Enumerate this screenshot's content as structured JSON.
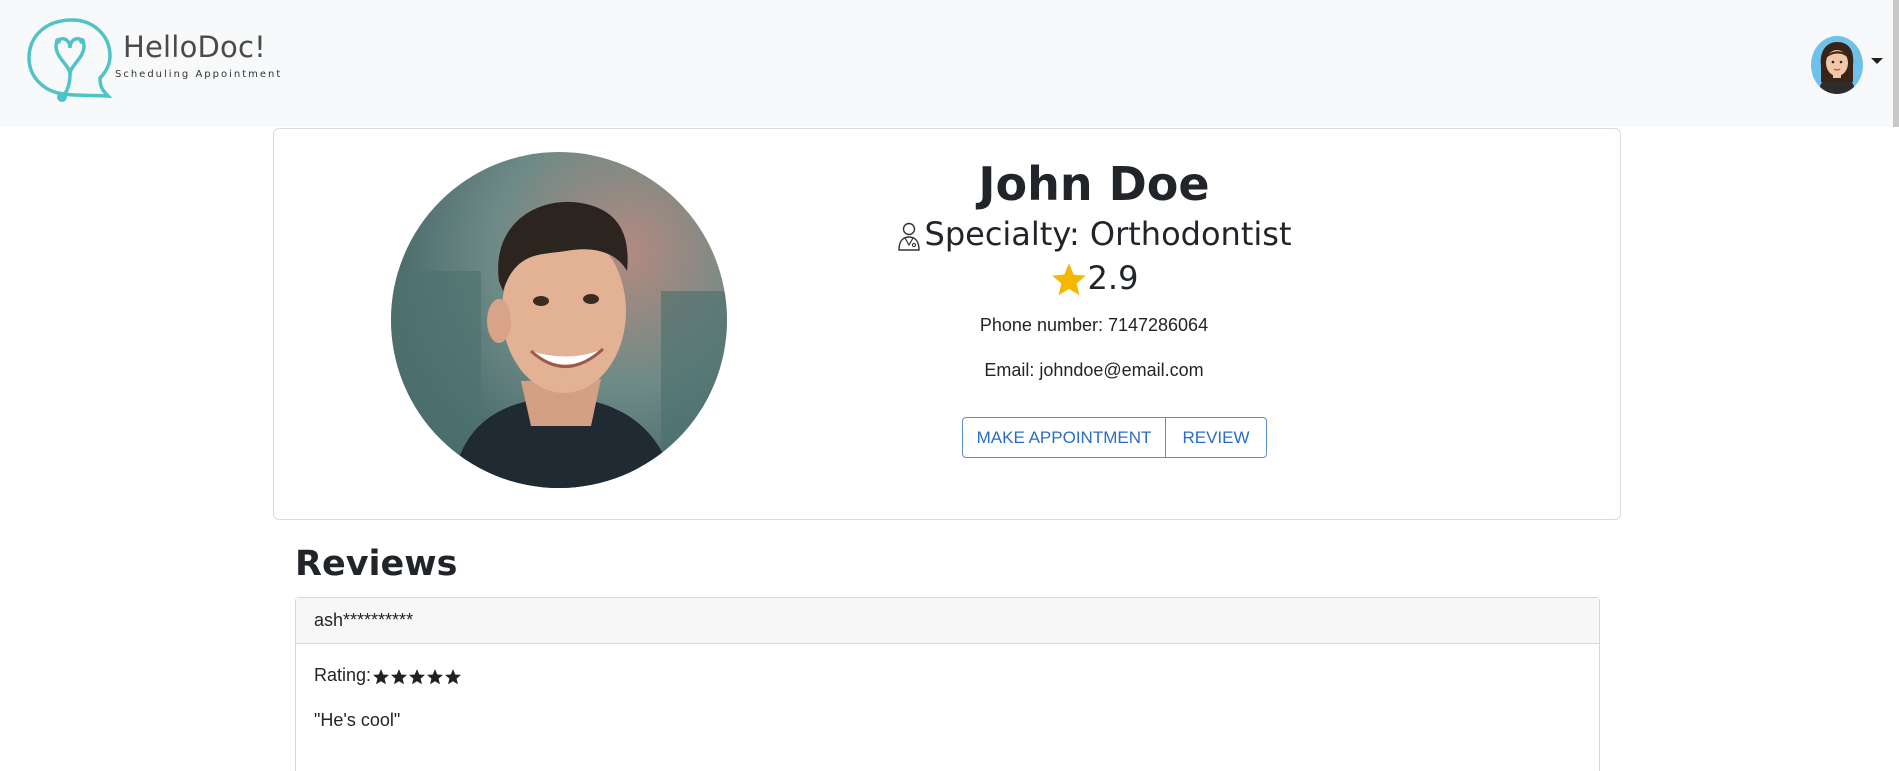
{
  "brand": {
    "name": "HelloDoc!",
    "tagline": "Scheduling Appointment"
  },
  "doctor": {
    "name": "John Doe",
    "specialty": "Specialty: Orthodontist",
    "rating": "2.9",
    "phone": "Phone number: 7147286064",
    "email": "Email: johndoe@email.com"
  },
  "actions": {
    "make_appointment": "MAKE APPOINTMENT",
    "review": "REVIEW"
  },
  "reviews": {
    "title": "Reviews",
    "items": [
      {
        "user": "ash**********",
        "rating_label": "Rating:",
        "stars": 5,
        "text": "\"He's cool\""
      }
    ]
  },
  "colors": {
    "accent": "#2b6cc4",
    "logo": "#4fc3c6",
    "star": "#f5b800",
    "navbar_bg": "#f8f9fa"
  },
  "icons": [
    "logo-icon",
    "user-avatar",
    "doctor-icon",
    "star-icon",
    "rating-star-icon"
  ]
}
